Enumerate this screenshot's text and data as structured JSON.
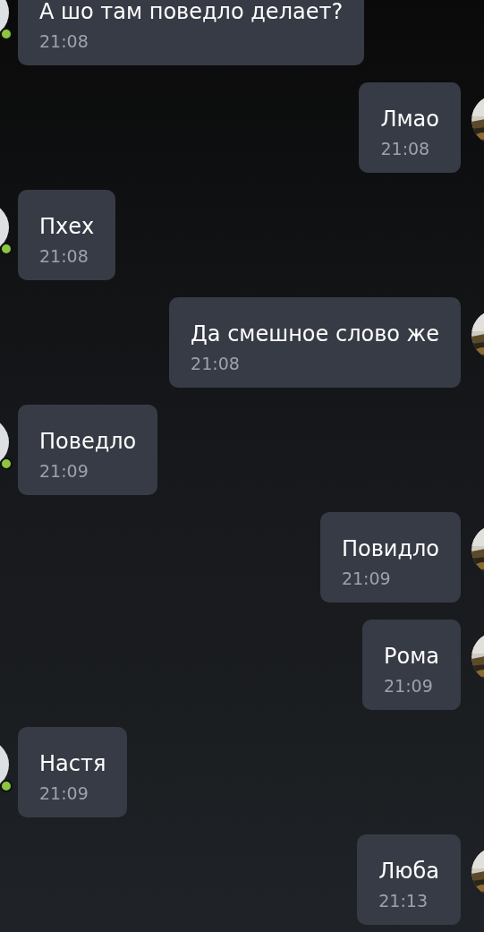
{
  "messages": [
    {
      "kind": "incoming",
      "online": true,
      "text": "А шо там поведло делает?",
      "time": "21:08"
    },
    {
      "kind": "outgoing",
      "text": "Лмао",
      "time": "21:08"
    },
    {
      "kind": "incoming",
      "online": true,
      "text": "Пхех",
      "time": "21:08"
    },
    {
      "kind": "outgoing",
      "text": "Да смешное слово же",
      "time": "21:08"
    },
    {
      "kind": "incoming",
      "online": true,
      "text": "Поведло",
      "time": "21:09"
    },
    {
      "kind": "outgoing",
      "text": "Повидло",
      "time": "21:09"
    },
    {
      "kind": "outgoing",
      "text": "Рома",
      "time": "21:09"
    },
    {
      "kind": "incoming",
      "online": true,
      "text": "Настя",
      "time": "21:09"
    },
    {
      "kind": "outgoing",
      "text": "Люба",
      "time": "21:13"
    }
  ]
}
